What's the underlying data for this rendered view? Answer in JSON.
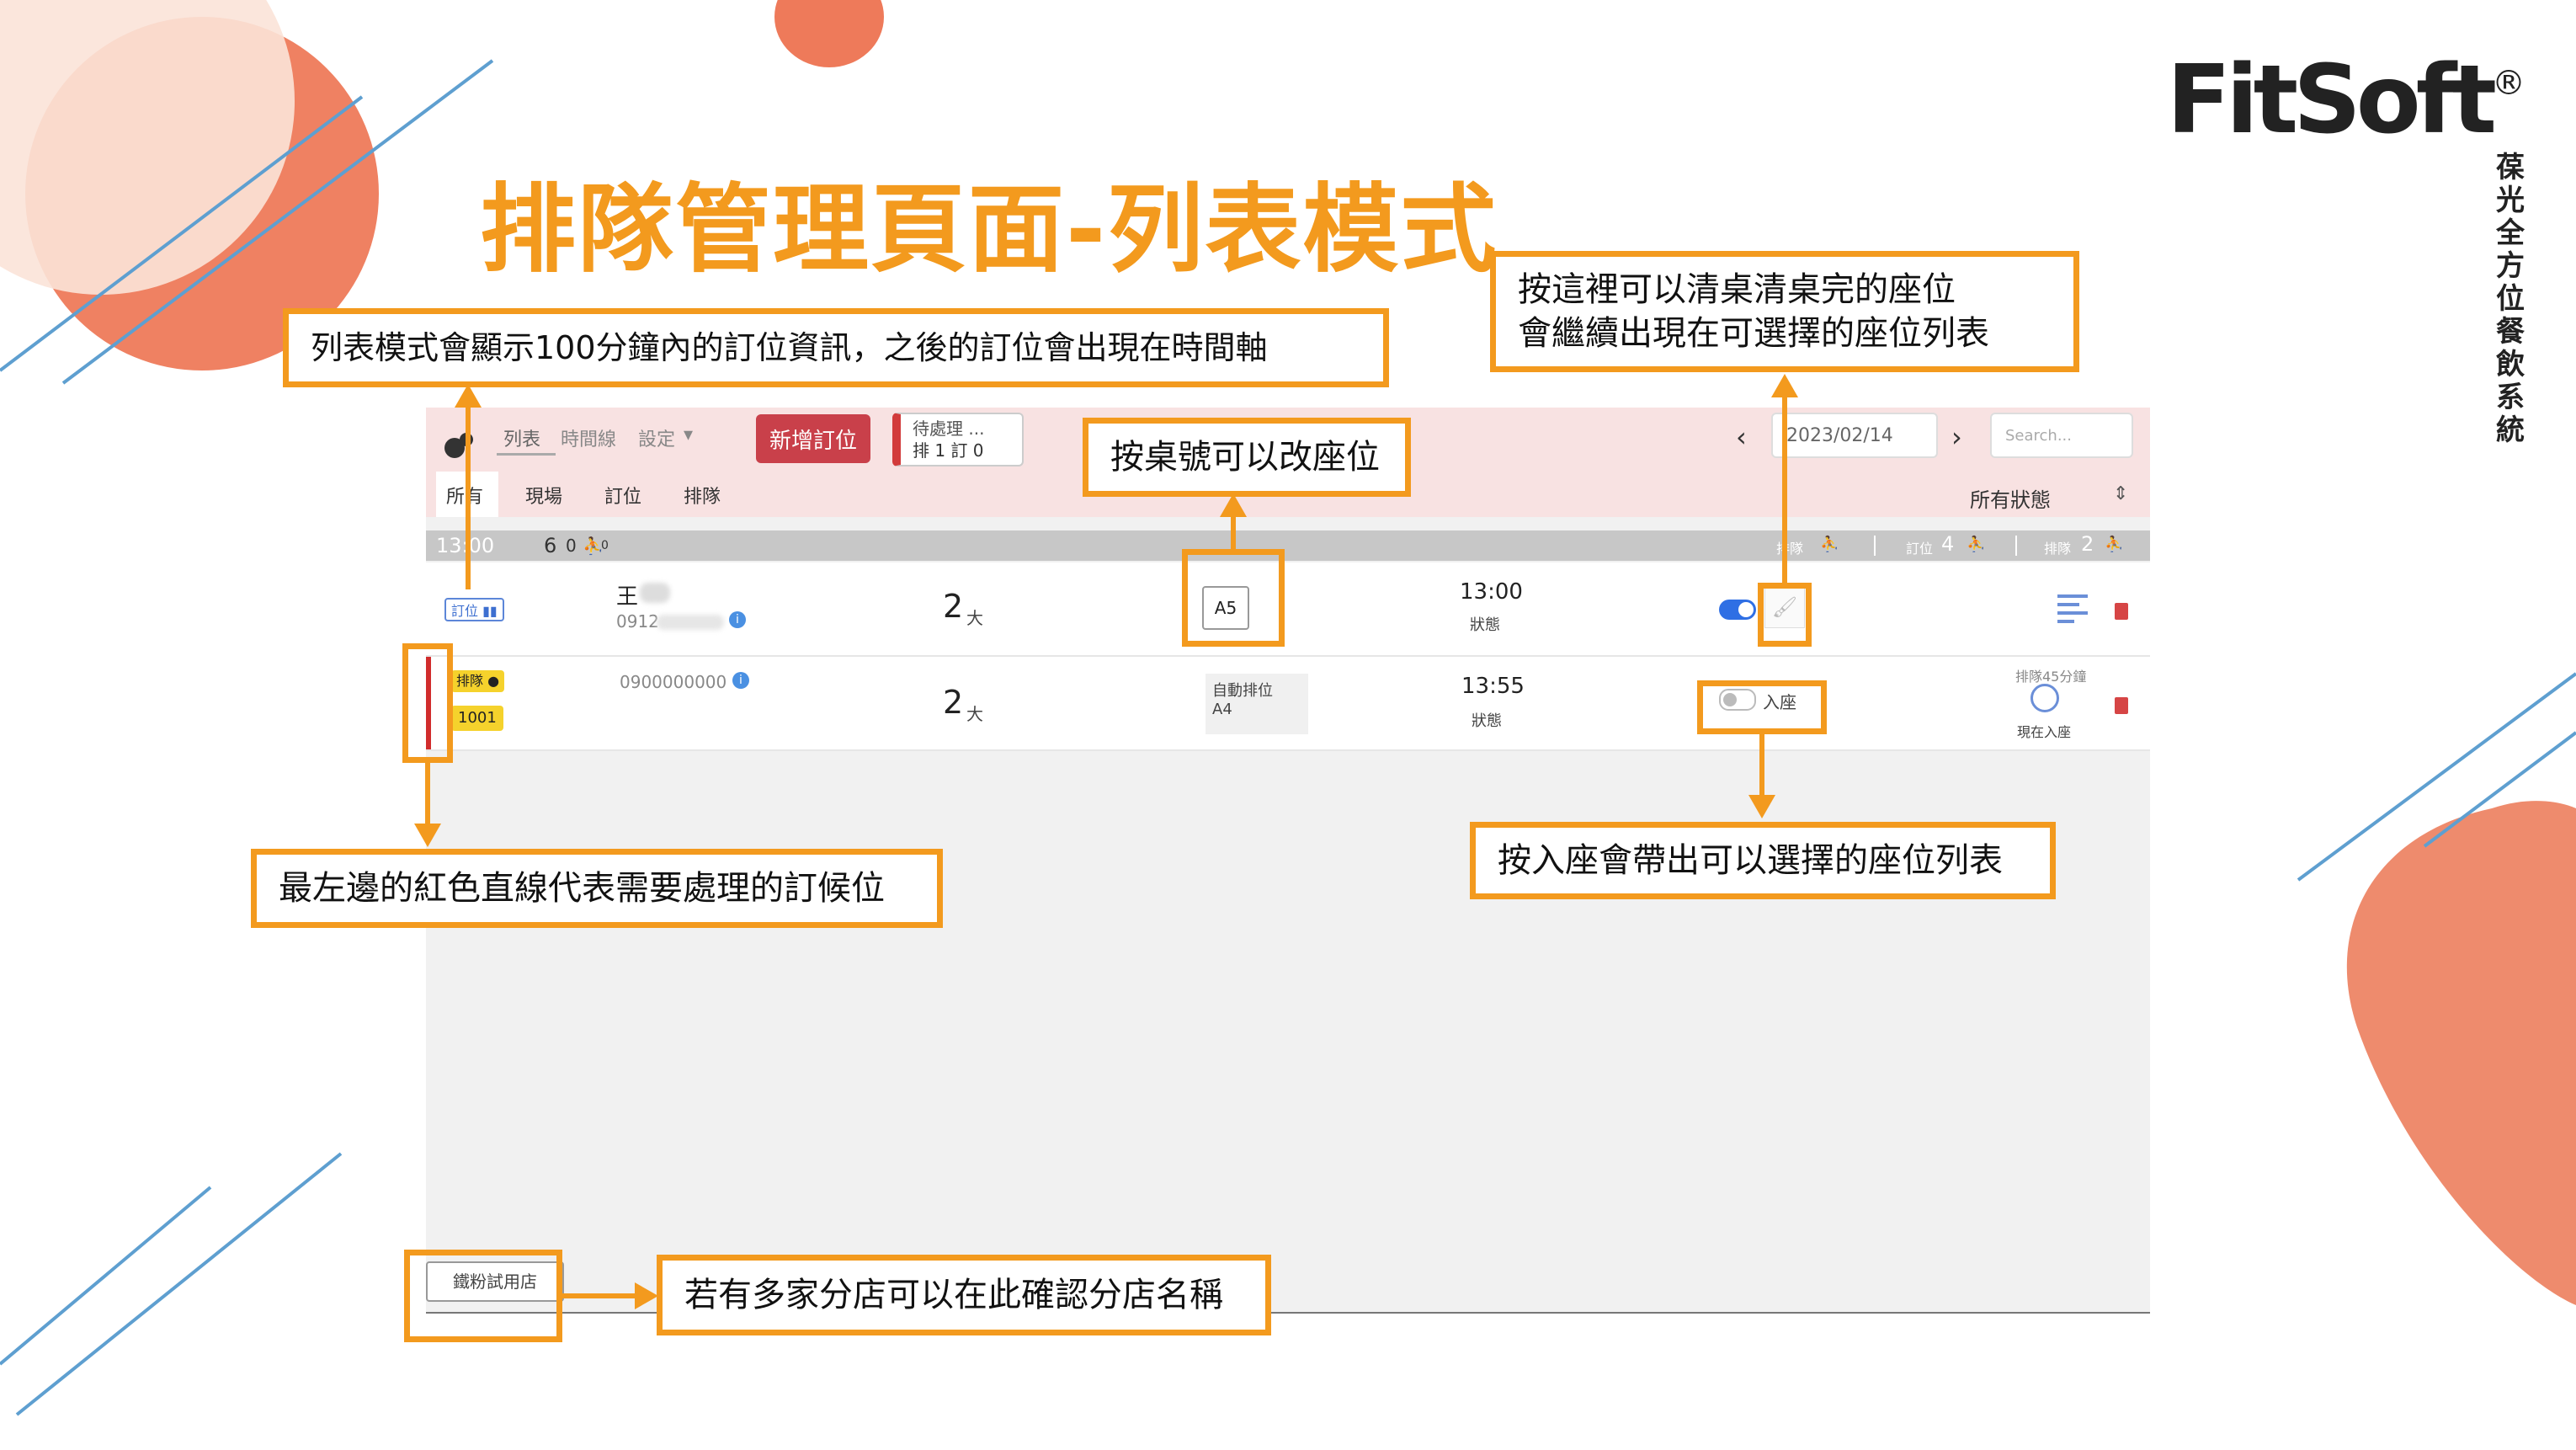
{
  "slide": {
    "title": "排隊管理頁面-列表模式",
    "brand": "FitSoft",
    "brand_mark": "®",
    "tagline": "葆光全方位餐飲系統",
    "colors": {
      "accent": "#f39a1e",
      "decor_orange": "#ee7a5a",
      "decor_line": "#5e9fd0"
    }
  },
  "callouts": {
    "list_mode": "列表模式會顯示100分鐘內的訂位資訊，之後的訂位會出現在時間軸",
    "clear_table_1": "按這裡可以清桌清桌完的座位",
    "clear_table_2": "會繼續出現在可選擇的座位列表",
    "change_seat": "按桌號可以改座位",
    "red_line": "最左邊的紅色直線代表需要處理的訂候位",
    "seat_in": "按入座會帶出可以選擇的座位列表",
    "branch": "若有多家分店可以在此確認分店名稱"
  },
  "app": {
    "nav": {
      "list": "列表",
      "timeline": "時間線",
      "settings": "設定",
      "settings_caret": "▾"
    },
    "new_booking": "新增訂位",
    "pending": {
      "line1": "待處理 ...",
      "line2": "排 1 訂 0"
    },
    "date": {
      "prev": "‹",
      "value": "2023/02/14",
      "next": "›"
    },
    "search_placeholder": "Search...",
    "tabs": [
      "所有",
      "現場",
      "訂位",
      "排隊"
    ],
    "status_filter": "所有狀態",
    "status_filter_caret": "⇕",
    "group": {
      "time": "13:00",
      "count": "6",
      "zero": "0",
      "zero2": "0",
      "queue_label": "排隊",
      "booking_label": "訂位",
      "booking_count": "4",
      "wait_label": "排隊",
      "wait_count": "2"
    },
    "rows": [
      {
        "type_badge": "訂位",
        "name": "王",
        "phone": "0912",
        "party": "2",
        "party_unit": "大",
        "table": "A5",
        "time": "13:00",
        "status": "狀態",
        "toggle_on": true
      },
      {
        "type_badge": "排隊",
        "queue_no": "1001",
        "phone": "0900000000",
        "party": "2",
        "party_unit": "大",
        "table_line1": "自動排位",
        "table_line2": "A4",
        "time": "13:55",
        "status": "狀態",
        "seat_label": "入座",
        "wait_text": "排隊45分鐘",
        "seat_now": "現在入座"
      }
    ],
    "branch_name": "鐵粉試用店"
  }
}
